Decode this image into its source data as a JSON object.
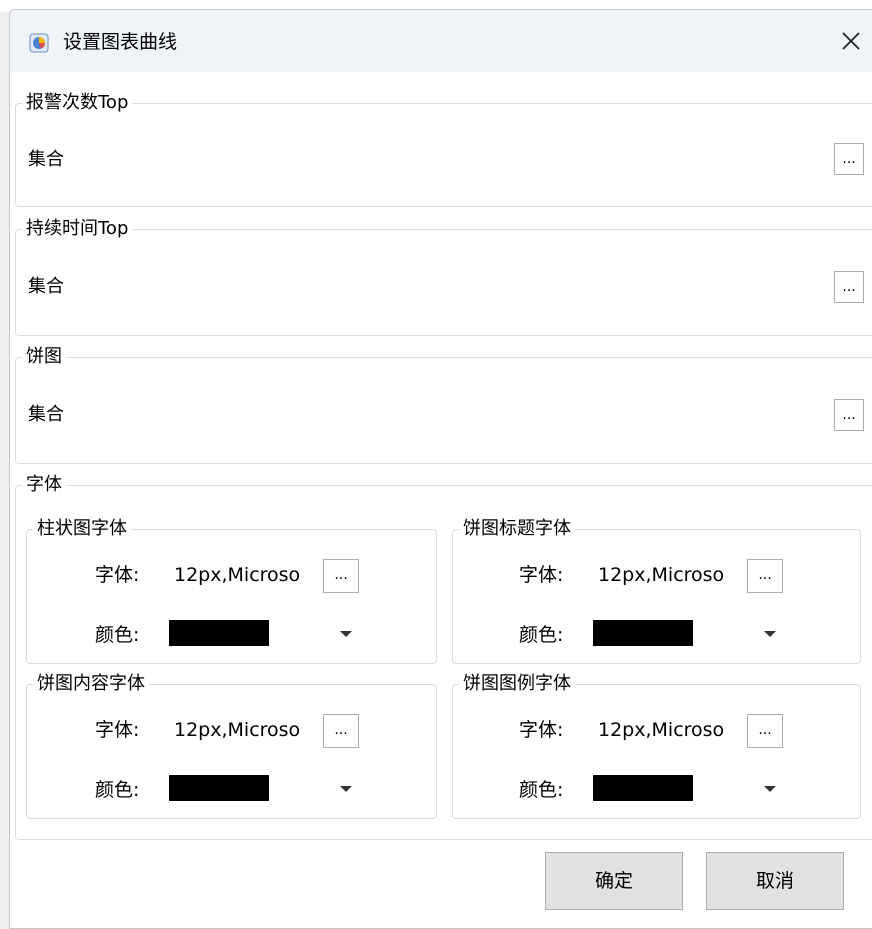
{
  "window": {
    "title": "设置图表曲线",
    "app_icon": "chart-app-icon",
    "close_icon": "close-icon"
  },
  "groups": [
    {
      "legend": "报警次数Top",
      "label": "集合",
      "button_label": "..."
    },
    {
      "legend": "持续时间Top",
      "label": "集合",
      "button_label": "..."
    },
    {
      "legend": "饼图",
      "label": "集合",
      "button_label": "..."
    }
  ],
  "font_group": {
    "legend": "字体",
    "subgroups": [
      {
        "legend": "柱状图字体",
        "font_label": "字体:",
        "font_value": "12px,Microso",
        "button_label": "...",
        "color_label": "颜色:",
        "color": "#000000"
      },
      {
        "legend": "饼图标题字体",
        "font_label": "字体:",
        "font_value": "12px,Microso",
        "button_label": "...",
        "color_label": "颜色:",
        "color": "#000000"
      },
      {
        "legend": "饼图内容字体",
        "font_label": "字体:",
        "font_value": "12px,Microso",
        "button_label": "...",
        "color_label": "颜色:",
        "color": "#000000"
      },
      {
        "legend": "饼图图例字体",
        "font_label": "字体:",
        "font_value": "12px,Microso",
        "button_label": "...",
        "color_label": "颜色:",
        "color": "#000000"
      }
    ]
  },
  "buttons": {
    "ok": "确定",
    "cancel": "取消"
  }
}
